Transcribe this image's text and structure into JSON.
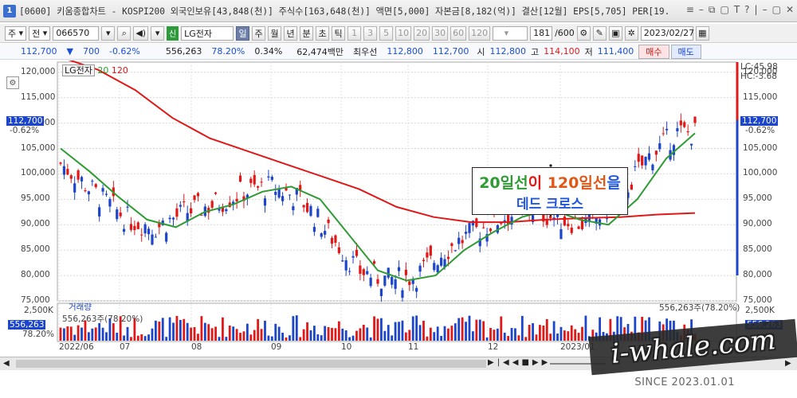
{
  "window": {
    "number": "1",
    "title": "[0600] 키움종합차트 - KOSPI200 외국인보유[43,848(천)] 주식수[163,648(천)] 액면[5,000] 자본금[8,182(억)] 결산[12월] EPS[5,705] PER[19.",
    "controls": [
      "≡",
      "–",
      "⧉",
      "▢",
      "T",
      "?",
      "|",
      "–",
      "▢",
      "✕"
    ]
  },
  "toolbar": {
    "chart_type": "주",
    "period_type": "전",
    "code": "066570",
    "shin": "신",
    "stock_name": "LG전자",
    "periods": [
      "일",
      "주",
      "월",
      "년",
      "분",
      "초",
      "틱"
    ],
    "active_period": "일",
    "intervals": [
      "1",
      "3",
      "5",
      "10",
      "20",
      "30",
      "60",
      "120"
    ],
    "count": "181",
    "count_max": "/600",
    "date": "2023/02/27"
  },
  "quote": {
    "price": "112,700",
    "change_arrow": "▼",
    "change": "700",
    "change_pct": "-0.62%",
    "volume": "556,263",
    "vol_ratio": "78.20%",
    "turnover": "0.34%",
    "amount": "62,474백만",
    "bid_label": "최우선",
    "bid1": "112,800",
    "bid2": "112,700",
    "open_label": "시",
    "open": "112,800",
    "high_label": "고",
    "high": "114,100",
    "low_label": "저",
    "low": "111,400",
    "buy_label": "매수",
    "sell_label": "매도"
  },
  "chart": {
    "legend_name": "LG전자",
    "legend_ma20": "20",
    "legend_ma120": "120",
    "lc": "LC:45.98",
    "hc": "HC:-3.68",
    "price_tag": "112,700",
    "price_tag_pct": "-0.62%",
    "volume_label": "거래량",
    "volume_value": "556,263주(78.20%)",
    "volume_value_right": "556,263주(78.20%)",
    "volume_tag": "556,263",
    "volume_tag_pct": "78.20%",
    "annotation_line1_part1": "20일선",
    "annotation_line1_part2": "이 ",
    "annotation_line1_part3": "120일선",
    "annotation_line1_part4": "을",
    "annotation_line2": "데드 크로스",
    "colors": {
      "up": "#e01818",
      "down": "#1d45c9",
      "ma20": "#2e9b33",
      "ma120": "#e01818"
    }
  },
  "watermark": {
    "text": "i-whale.com",
    "since": "SINCE 2023.01.01"
  },
  "chart_data": {
    "type": "candlestick",
    "price_axis": [
      "120,000",
      "115,000",
      "110,000",
      "105,000",
      "100,000",
      "95,000",
      "90,000",
      "85,000",
      "80,000",
      "75,000"
    ],
    "price_values": [
      120000,
      115000,
      110000,
      105000,
      100000,
      95000,
      90000,
      85000,
      80000,
      75000
    ],
    "volume_axis": [
      "2,500K"
    ],
    "x_labels": [
      "2022/06",
      "07",
      "08",
      "09",
      "10",
      "11",
      "12",
      "2023/01"
    ],
    "ylim": [
      75000,
      122000
    ],
    "ma20": [
      105000,
      100500,
      95500,
      91000,
      89500,
      92500,
      94000,
      96500,
      97500,
      95000,
      88000,
      81000,
      79000,
      80000,
      85000,
      88500,
      91500,
      93000,
      91000,
      90000,
      95000,
      103000,
      108000
    ],
    "ma120": [
      123000,
      120500,
      116500,
      111000,
      107000,
      104500,
      102000,
      99500,
      97000,
      93500,
      91500,
      90500,
      90500,
      91000,
      91300,
      91500,
      92000,
      92300
    ],
    "annotation": "20일선이 120일선을 데드 크로스",
    "grid": true
  }
}
